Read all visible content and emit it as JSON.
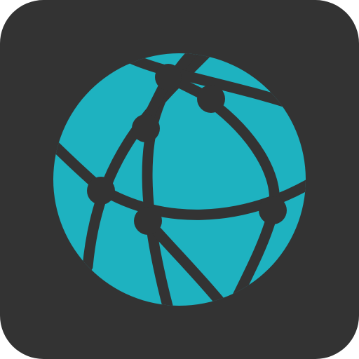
{
  "app_icon": {
    "icon_name": "network-globe-icon",
    "background_color": "#333333",
    "globe_color": "#1eb2c0",
    "line_color": "#333333"
  }
}
